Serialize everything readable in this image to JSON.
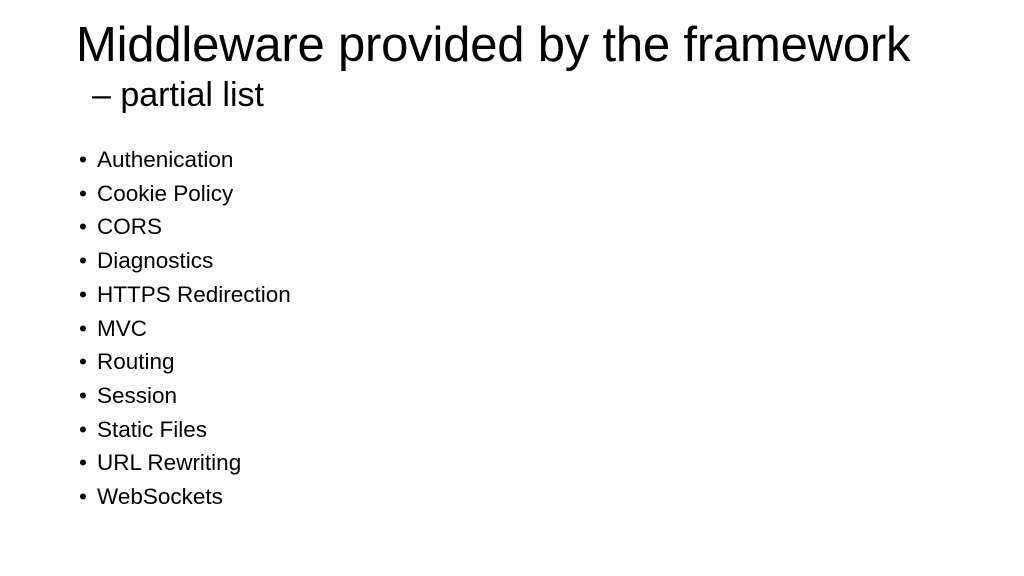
{
  "slide": {
    "background_color": "#ffffff",
    "text_color": "#000000",
    "title": "Middleware provided by the framework",
    "subtitle": "– partial list",
    "bullet_marker": "•",
    "bullets": [
      {
        "label": "Authenication"
      },
      {
        "label": "Cookie Policy"
      },
      {
        "label": "CORS"
      },
      {
        "label": "Diagnostics"
      },
      {
        "label": "HTTPS Redirection"
      },
      {
        "label": "MVC"
      },
      {
        "label": "Routing"
      },
      {
        "label": "Session"
      },
      {
        "label": "Static Files"
      },
      {
        "label": "URL Rewriting"
      },
      {
        "label": "WebSockets"
      }
    ]
  }
}
